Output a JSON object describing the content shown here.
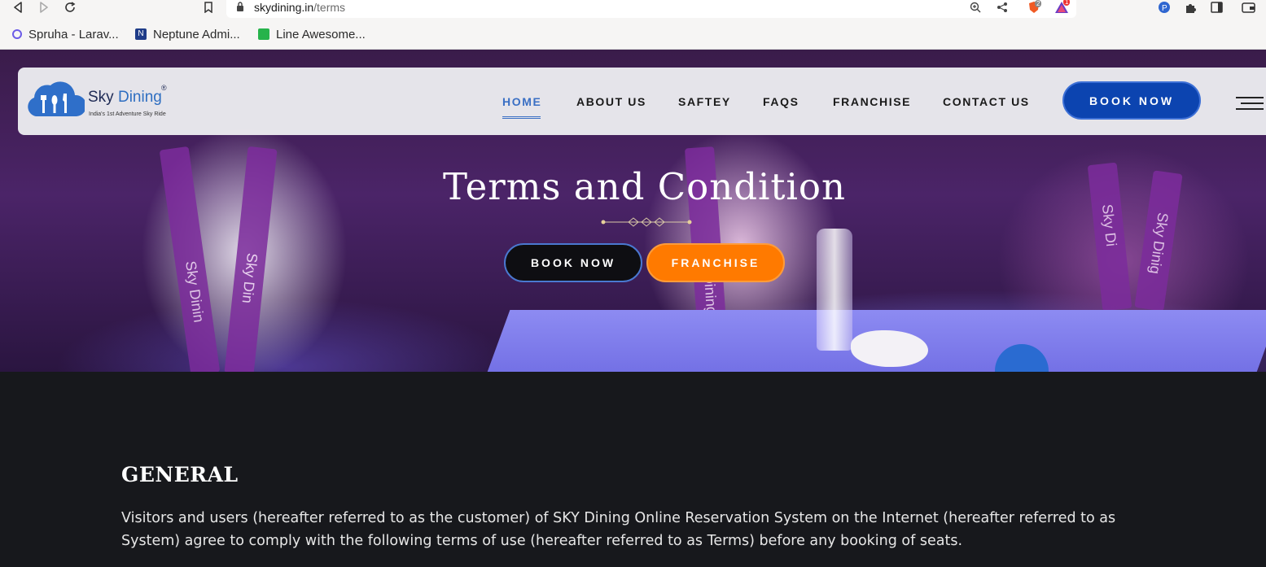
{
  "browser": {
    "url_domain": "skydining.in",
    "url_path": "/terms",
    "bookmarks": [
      {
        "label": "Spruha - Larav..."
      },
      {
        "label": "Neptune Admi..."
      },
      {
        "label": "Line Awesome..."
      }
    ],
    "brave_badge": "2",
    "alert_badge": "1"
  },
  "header": {
    "logo_sky": "Sky",
    "logo_dining": "Dining",
    "logo_tagline": "India's 1st Adventure Sky Ride",
    "logo_reg": "®",
    "nav": [
      {
        "label": "HOME"
      },
      {
        "label": "ABOUT US"
      },
      {
        "label": "SAFTEY"
      },
      {
        "label": "FAQS"
      },
      {
        "label": "FRANCHISE"
      },
      {
        "label": "CONTACT US"
      }
    ],
    "book_now": "BOOK NOW"
  },
  "hero": {
    "title": "Terms and Condition",
    "book_now": "BOOK NOW",
    "franchise": "FRANCHISE"
  },
  "content": {
    "section_title": "GENERAL",
    "paragraph": "Visitors and users (hereafter referred to as the customer) of SKY Dining Online Reservation System on the Internet (hereafter referred to as System) agree to comply with the following terms of use (hereafter referred to as Terms) before any booking of seats."
  },
  "colors": {
    "accent_blue": "#0c44b0",
    "accent_orange": "#ff7a00",
    "active_nav": "#3a6fc4",
    "dark_bg": "#17181c"
  }
}
